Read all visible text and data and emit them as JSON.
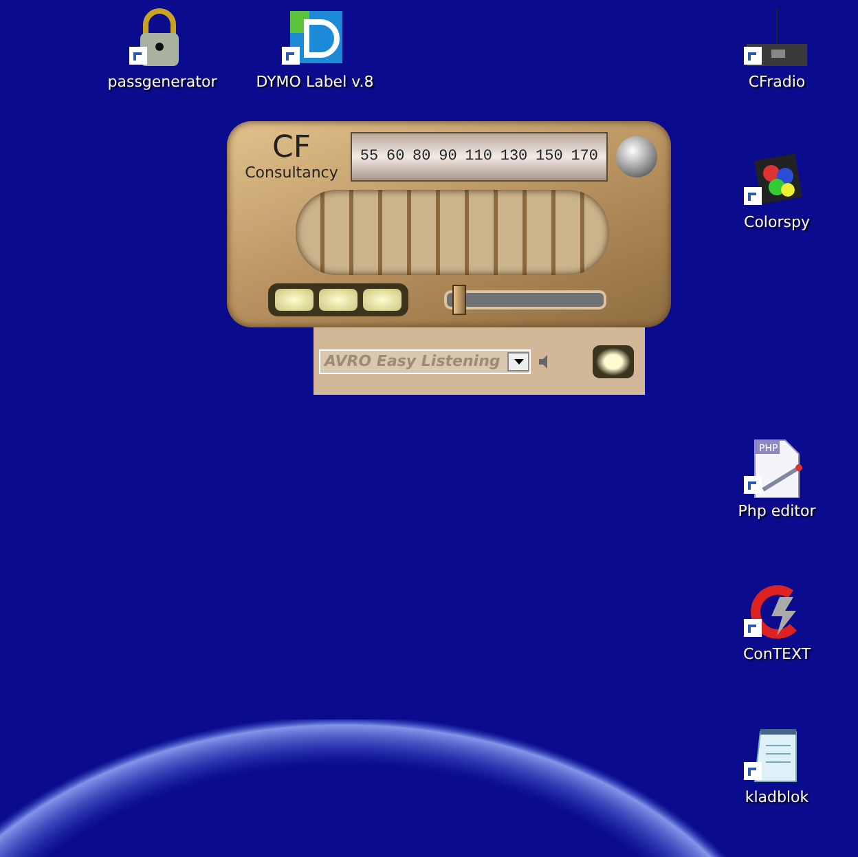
{
  "top_icons": [
    {
      "label": "passgenerator",
      "kind": "lock"
    },
    {
      "label": "DYMO Label v.8",
      "kind": "dymo"
    }
  ],
  "right_icons": [
    {
      "label": "CFradio",
      "kind": "radio"
    },
    {
      "label": "Colorspy",
      "kind": "colorspy"
    },
    {
      "label": "Php editor",
      "kind": "php",
      "badge": "PHP"
    },
    {
      "label": "ConTEXT",
      "kind": "context"
    },
    {
      "label": "kladblok",
      "kind": "notepad"
    }
  ],
  "radio": {
    "logo": "CF",
    "brand": "Consultancy",
    "dial": [
      "55",
      "60",
      "80",
      "90",
      "110",
      "130",
      "150",
      "170"
    ],
    "volume": {
      "level": 0.05
    },
    "station": {
      "value": "AVRO Easy Listening"
    }
  }
}
